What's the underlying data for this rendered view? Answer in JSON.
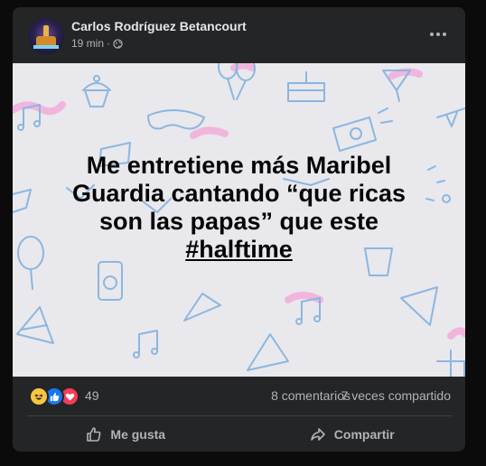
{
  "post": {
    "author": "Carlos Rodríguez Betancourt",
    "time": "19 min",
    "separator": "·",
    "privacy_icon": "globe-icon",
    "more_icon": "more-options-icon"
  },
  "image": {
    "line1": "Me entretiene más Maribel",
    "line2": "Guardia cantando “que ricas",
    "line3": "son las papas” que este",
    "hashtag": "#halftime",
    "background_color": "#e9e8ed"
  },
  "stats": {
    "reactions": [
      "haha-icon",
      "like-icon",
      "love-icon"
    ],
    "reaction_count": "49",
    "comments": "8 comentarios",
    "shares": "7 veces compartido"
  },
  "actions": {
    "like_label": "Me gusta",
    "share_label": "Compartir"
  },
  "colors": {
    "card": "#242526",
    "text_primary": "#e4e6eb",
    "text_secondary": "#b0b3b8",
    "like_blue": "#1877f2",
    "love_red": "#f33e58",
    "haha_yellow": "#f7c640"
  }
}
